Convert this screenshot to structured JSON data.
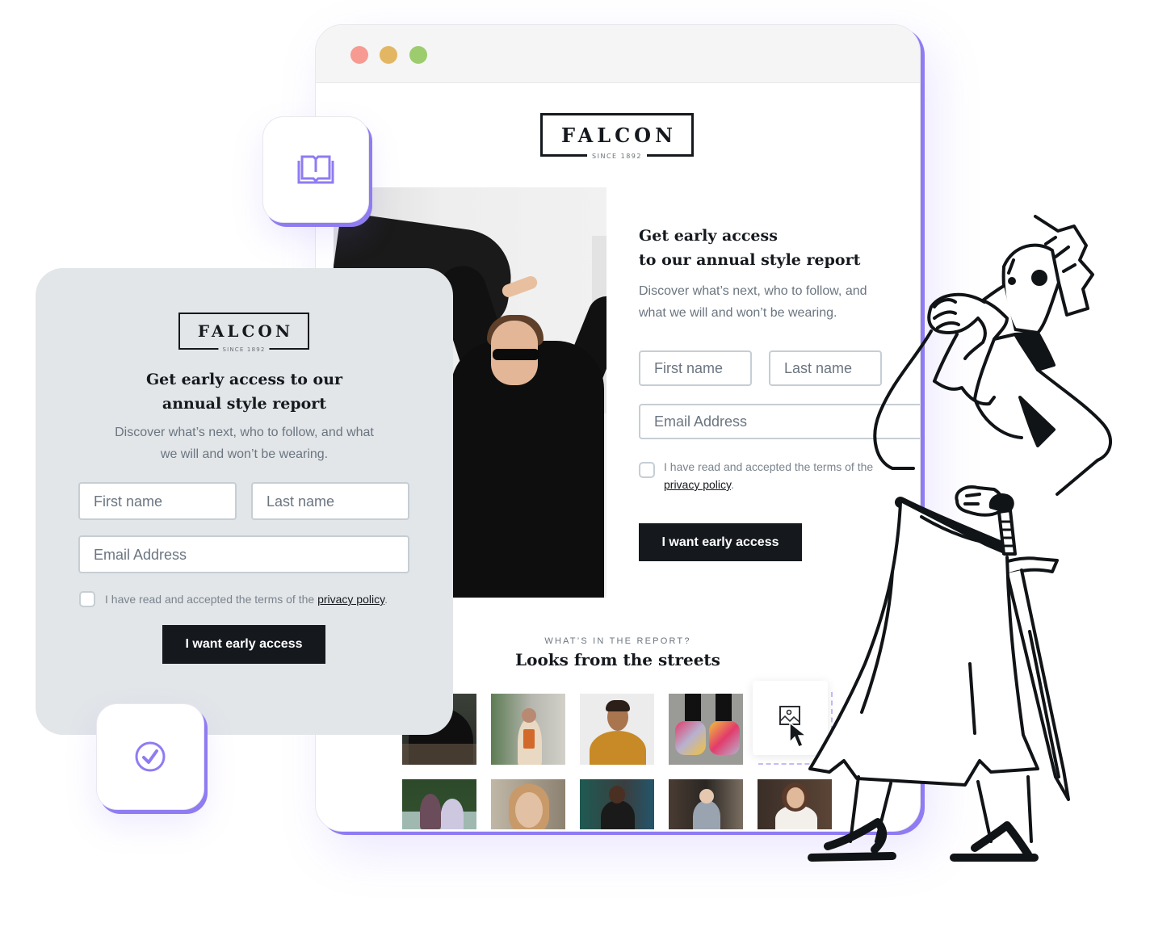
{
  "browser": {
    "window_controls": [
      "close",
      "minimize",
      "maximize"
    ],
    "colors": {
      "close": "#f69a92",
      "minimize": "#e2b662",
      "maximize": "#9ccc6e",
      "accent": "#8f7cf2"
    }
  },
  "brand": {
    "name": "FALCON",
    "tagline": "SINCE 1892"
  },
  "landing": {
    "title_line1": "Get early access",
    "title_line2": "to our annual style report",
    "description_line1": "Discover what’s next, who to follow, and",
    "description_line2": "what we will and won’t be wearing.",
    "form": {
      "first_name_placeholder": "First name",
      "last_name_placeholder": "Last name",
      "email_placeholder": "Email Address",
      "terms_text": "I have read and accepted the terms of the",
      "privacy_link": "privacy policy",
      "terms_suffix": ".",
      "submit_label": "I want early access"
    },
    "report": {
      "eyebrow": "WHAT’S IN THE REPORT?",
      "title": "Looks from the streets",
      "gallery": [
        {
          "alt": "person in black hoodie"
        },
        {
          "alt": "woman stretching arms"
        },
        {
          "alt": "man in mustard sweater"
        },
        {
          "alt": "colorful sneakers"
        },
        {
          "alt": "image placeholder drop zone"
        },
        {
          "alt": "two friends on a car"
        },
        {
          "alt": "girl with glasses"
        },
        {
          "alt": "man in leather jacket"
        },
        {
          "alt": "man seated in floral shirt"
        },
        {
          "alt": "woman in glasses smiling"
        }
      ]
    }
  },
  "popup": {
    "title_line1": "Get early access to our",
    "title_line2": "annual style report",
    "description_line1": "Discover what’s next, who to follow, and what",
    "description_line2": "we will and won’t be wearing.",
    "form": {
      "first_name_placeholder": "First name",
      "last_name_placeholder": "Last name",
      "email_placeholder": "Email Address",
      "terms_text": "I have read and accepted the terms of the",
      "privacy_link": "privacy policy",
      "terms_suffix": ".",
      "submit_label": "I want early access"
    }
  },
  "tiles": [
    {
      "icon": "book-open-icon"
    },
    {
      "icon": "check-circle-icon"
    }
  ],
  "illustration": {
    "subject": "warrior-with-sword"
  }
}
